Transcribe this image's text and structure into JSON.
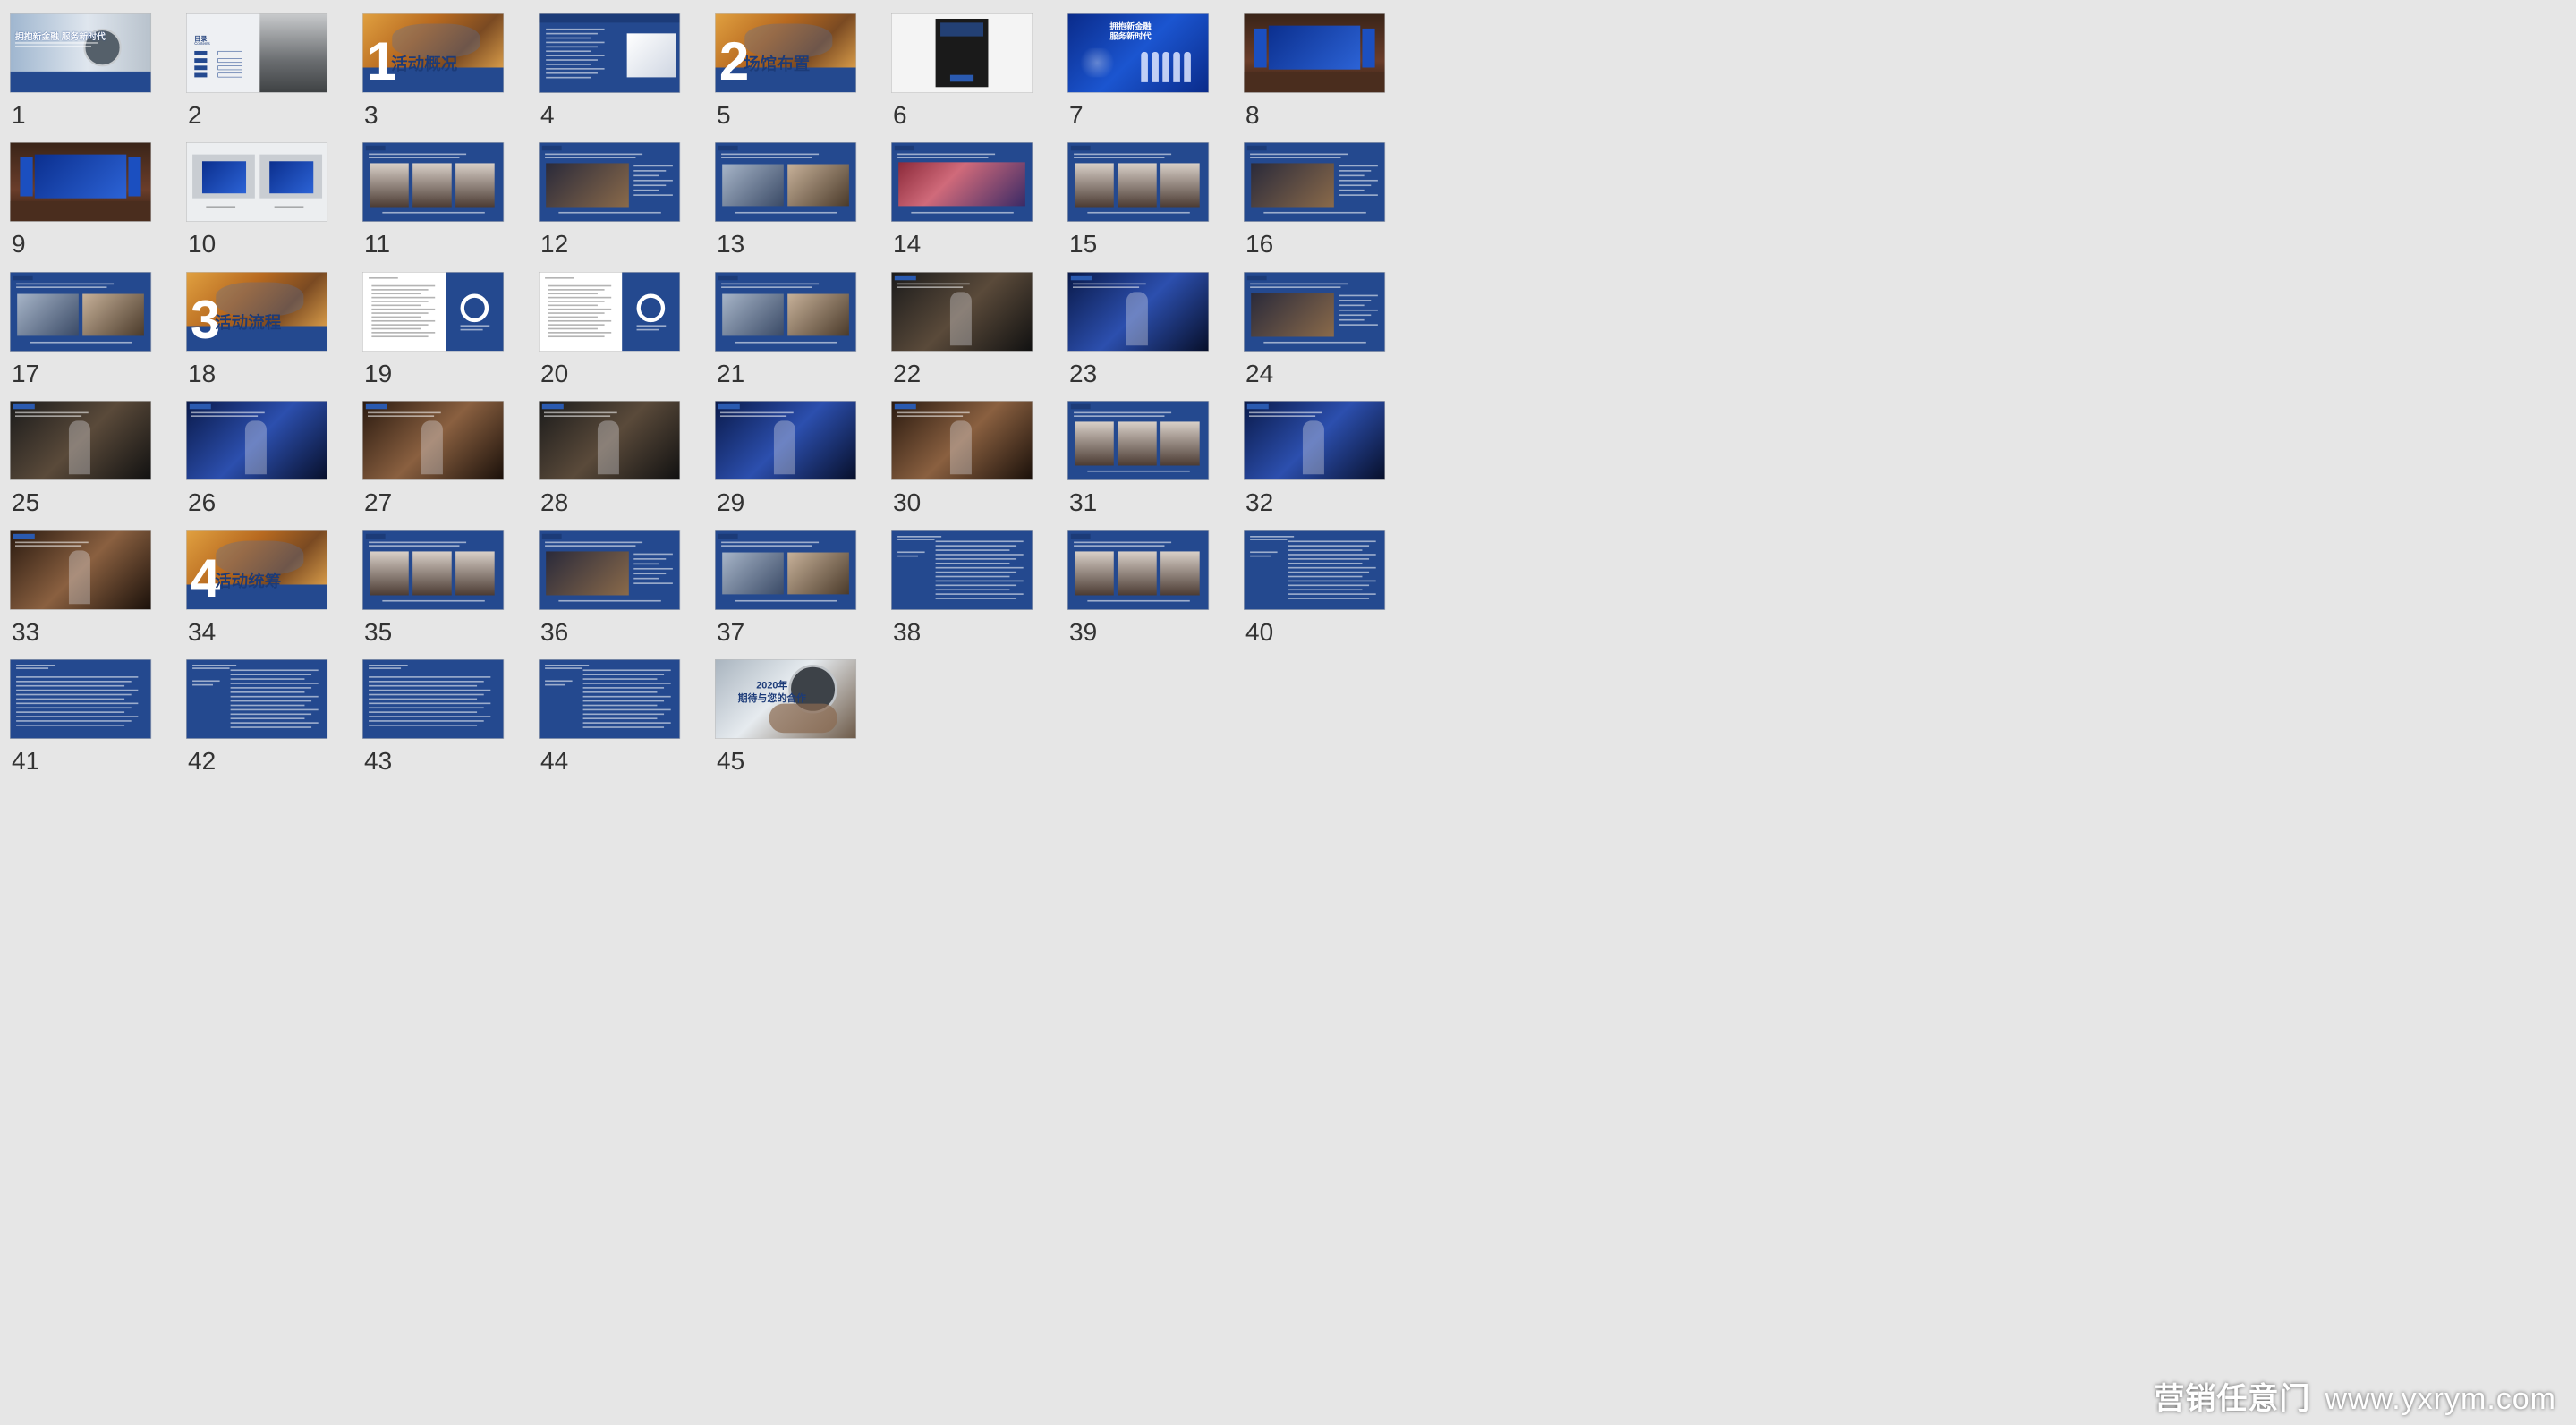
{
  "slides": [
    {
      "number": "1",
      "theme": "cover",
      "title": "拥抱新金融   服务新时代"
    },
    {
      "number": "2",
      "theme": "toc",
      "title": "目录",
      "subtitle": "Contents"
    },
    {
      "number": "3",
      "theme": "section",
      "section_number": "1",
      "title": "活动概况"
    },
    {
      "number": "4",
      "theme": "text-photo"
    },
    {
      "number": "5",
      "theme": "section",
      "section_number": "2",
      "title": "场馆布置"
    },
    {
      "number": "6",
      "theme": "floorplan"
    },
    {
      "number": "7",
      "theme": "poster",
      "title": "拥抱新金融\n服务新时代"
    },
    {
      "number": "8",
      "theme": "stage"
    },
    {
      "number": "9",
      "theme": "stage"
    },
    {
      "number": "10",
      "theme": "mockup"
    },
    {
      "number": "11",
      "theme": "blue-photo"
    },
    {
      "number": "12",
      "theme": "blue-photo"
    },
    {
      "number": "13",
      "theme": "blue-photo"
    },
    {
      "number": "14",
      "theme": "blue-photo"
    },
    {
      "number": "15",
      "theme": "blue-photo"
    },
    {
      "number": "16",
      "theme": "blue-photo"
    },
    {
      "number": "17",
      "theme": "blue-photo"
    },
    {
      "number": "18",
      "theme": "section",
      "section_number": "3",
      "title": "活动流程"
    },
    {
      "number": "19",
      "theme": "schedule"
    },
    {
      "number": "20",
      "theme": "schedule"
    },
    {
      "number": "21",
      "theme": "blue-photo"
    },
    {
      "number": "22",
      "theme": "dark-photo"
    },
    {
      "number": "23",
      "theme": "dark-photo"
    },
    {
      "number": "24",
      "theme": "blue-photo"
    },
    {
      "number": "25",
      "theme": "dark-photo"
    },
    {
      "number": "26",
      "theme": "dark-photo"
    },
    {
      "number": "27",
      "theme": "dark-photo"
    },
    {
      "number": "28",
      "theme": "dark-photo"
    },
    {
      "number": "29",
      "theme": "dark-photo"
    },
    {
      "number": "30",
      "theme": "dark-photo"
    },
    {
      "number": "31",
      "theme": "blue-photo"
    },
    {
      "number": "32",
      "theme": "dark-photo"
    },
    {
      "number": "33",
      "theme": "dark-photo"
    },
    {
      "number": "34",
      "theme": "section",
      "section_number": "4",
      "title": "活动统筹"
    },
    {
      "number": "35",
      "theme": "blue-photo"
    },
    {
      "number": "36",
      "theme": "blue-photo"
    },
    {
      "number": "37",
      "theme": "blue-photo"
    },
    {
      "number": "38",
      "theme": "blue-text"
    },
    {
      "number": "39",
      "theme": "blue-photo"
    },
    {
      "number": "40",
      "theme": "blue-text"
    },
    {
      "number": "41",
      "theme": "blue-text"
    },
    {
      "number": "42",
      "theme": "blue-text"
    },
    {
      "number": "43",
      "theme": "blue-text"
    },
    {
      "number": "44",
      "theme": "blue-text"
    },
    {
      "number": "45",
      "theme": "closing",
      "title": "2020年\n期待与您的合作"
    }
  ],
  "watermark": {
    "cn": "营销任意门",
    "url": "www.yxrym.com"
  },
  "colors": {
    "background": "#e6e6e6",
    "slide_blue": "#24498f",
    "accent_orange": "#c47a2c"
  }
}
